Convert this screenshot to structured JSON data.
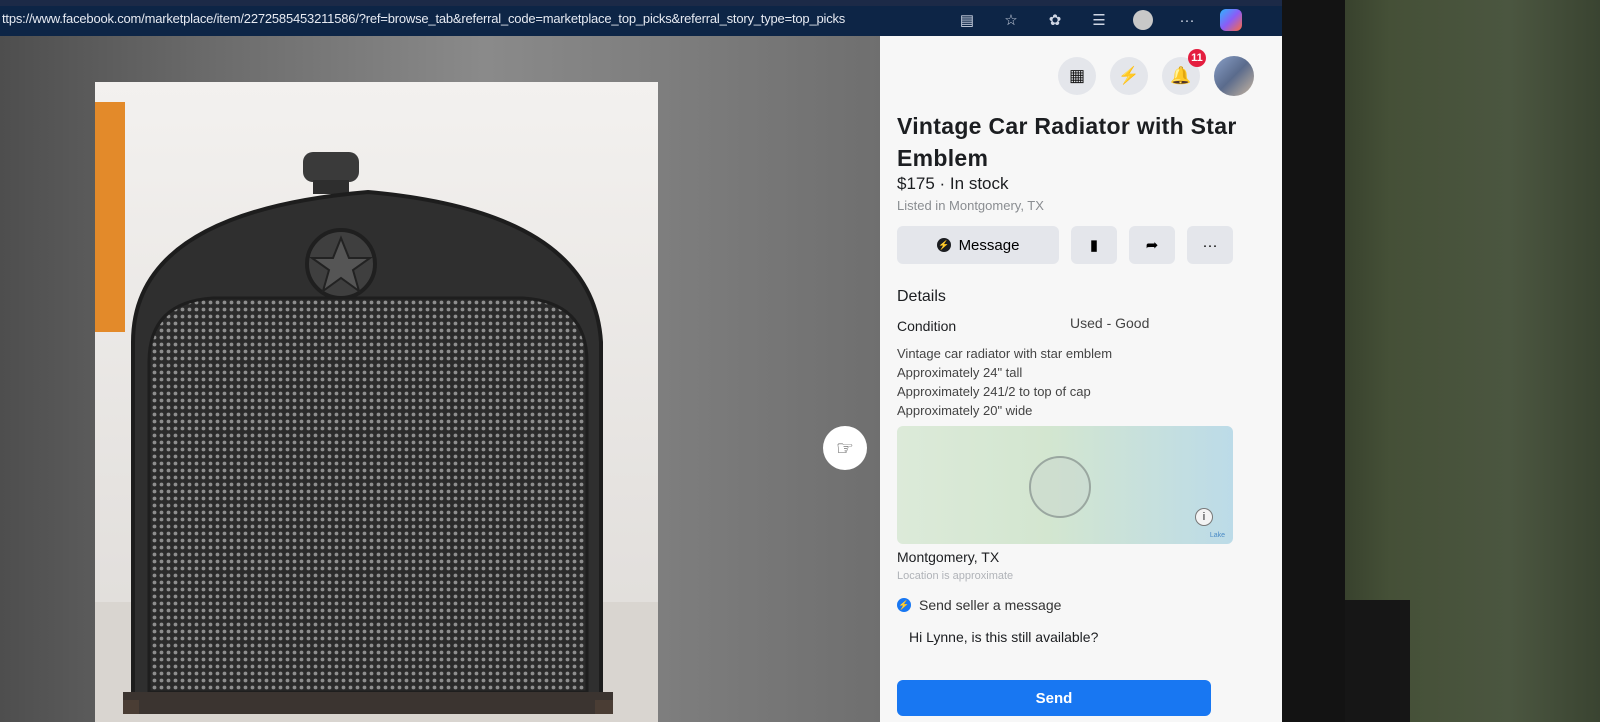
{
  "browser": {
    "url": "ttps://www.facebook.com/marketplace/item/2272585453211586/?ref=browse_tab&referral_code=marketplace_top_picks&referral_story_type=top_picks",
    "more": "···"
  },
  "topbar": {
    "notifications_count": "11"
  },
  "listing": {
    "title": "Vintage Car Radiator with Star Emblem",
    "price_status": "$175 · In stock",
    "listed_in": "Listed in Montgomery, TX",
    "message_label": "Message",
    "more_label": "···"
  },
  "details": {
    "heading": "Details",
    "condition_label": "Condition",
    "condition_value": "Used - Good",
    "description": [
      "Vintage car radiator with star emblem",
      "Approximately 24\" tall",
      "Approximately 241/2 to top of cap",
      "Approximately 20\" wide"
    ]
  },
  "location": {
    "city": "Montgomery, TX",
    "note": "Location is approximate",
    "map_label": "Lake"
  },
  "message_box": {
    "heading": "Send seller a message",
    "text": "Hi Lynne, is this still available?",
    "send_label": "Send"
  },
  "icons": {
    "grid": "menu-grid-icon",
    "messenger": "messenger-icon",
    "bell": "bell-icon",
    "save": "bookmark-icon",
    "share": "share-icon"
  },
  "colors": {
    "accent": "#1877f2",
    "badge": "#e41e3f",
    "addressbar": "#0d2546"
  }
}
